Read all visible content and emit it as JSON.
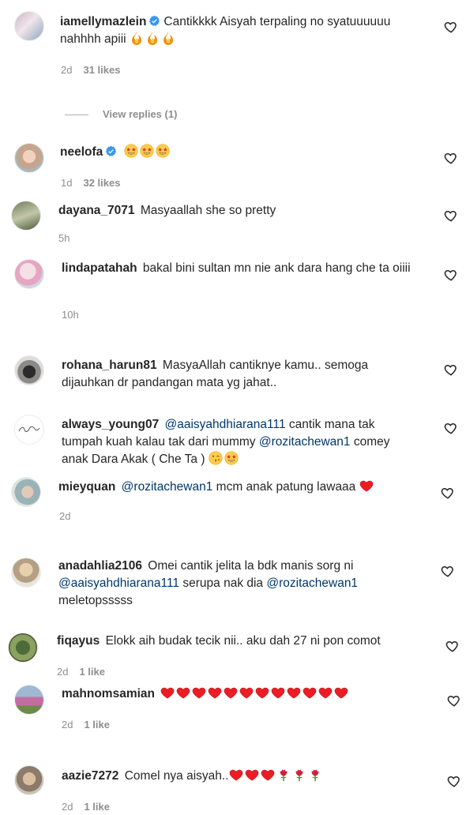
{
  "comments": [
    {
      "id": "c1",
      "username": "iamellymazlein",
      "verified": true,
      "text": "Cantikkkk Aisyah terpaling no syatuuuuuu nahhhh apiii",
      "emoji": [
        "fire",
        "fire",
        "fire"
      ],
      "time": "2d",
      "likes": "31 likes"
    },
    {
      "id": "c2",
      "username": "neelofa",
      "verified": true,
      "text": "",
      "emoji": [
        "star-struck",
        "star-struck",
        "star-struck"
      ],
      "time": "1d",
      "likes": "32 likes"
    },
    {
      "id": "c3",
      "username": "dayana_7071",
      "text": "Masyaallah she so pretty",
      "time": "5h"
    },
    {
      "id": "c4",
      "username": "lindapatahah",
      "text": "bakal bini sultan mn nie ank dara hang che ta oiiii",
      "time": "10h"
    },
    {
      "id": "c5",
      "username": "rohana_harun81",
      "text": "MasyaAllah cantiknye kamu.. semoga dijauhkan dr pandangan mata yg jahat.."
    },
    {
      "id": "c6",
      "username": "always_young07",
      "mention1": "@aaisyahdhiarana111",
      "text1": "cantik mana tak tumpah kuah kalau tak dari mummy",
      "mention2": "@rozitachewan1",
      "text2": "comey anak Dara Akak ( Che Ta )",
      "emoji": [
        "wink-kiss",
        "star-struck"
      ]
    },
    {
      "id": "c7",
      "username": "mieyquan",
      "mention1": "@rozitachewan1",
      "text1": "mcm anak patung lawaaa",
      "emoji": [
        "heart"
      ],
      "time": "2d"
    },
    {
      "id": "c8",
      "username": "anadahlia2106",
      "text1": "Omei cantik jelita la bdk manis sorg ni",
      "mention1": "@aaisyahdhiarana111",
      "text2": "serupa nak dia",
      "mention2": "@rozitachewan1",
      "text3": "meletopsssss"
    },
    {
      "id": "c9",
      "username": "fiqayus",
      "text": "Elokk aih budak tecik nii.. aku dah 27 ni pon comot",
      "time": "2d",
      "likes": "1 like"
    },
    {
      "id": "c10",
      "username": "mahnomsamian",
      "emoji": [
        "heart",
        "heart",
        "heart",
        "heart",
        "heart",
        "heart",
        "heart",
        "heart",
        "heart",
        "heart",
        "heart",
        "heart"
      ],
      "time": "2d",
      "likes": "1 like"
    },
    {
      "id": "c11",
      "username": "aazie7272",
      "text": "Comel nya aisyah..",
      "emoji": [
        "heart",
        "heart",
        "heart",
        "rose",
        "rose",
        "rose"
      ],
      "time": "2d",
      "likes": "1 like"
    }
  ],
  "view_replies": "View replies (1)",
  "colors": {
    "text": "#262626",
    "secondary": "#8e8e8e",
    "mention": "#00376b",
    "heart": "#ed1c24",
    "verified": "#3897f0"
  }
}
